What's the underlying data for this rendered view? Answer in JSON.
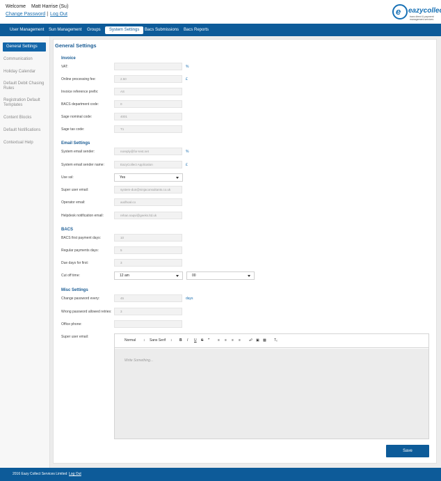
{
  "header": {
    "welcome_label": "Welcome",
    "user_name": "Matt Harrise (Su)",
    "change_password": "Change Password",
    "separator": "|",
    "log_out": "Log Out",
    "logo": {
      "word": "eazycollect",
      "tagline": "bacs direct & payment management services"
    }
  },
  "nav": {
    "items": [
      {
        "label": "User Management"
      },
      {
        "label": "Sun Management"
      },
      {
        "label": "Groups"
      },
      {
        "label": "System Settings"
      },
      {
        "label": "Bacs Submissions"
      },
      {
        "label": "Bacs Reports"
      }
    ],
    "active_item": "System Settings"
  },
  "sidebar": {
    "items": [
      {
        "label": "General Settings"
      },
      {
        "label": "Communication"
      },
      {
        "label": "Holiday Calendar"
      },
      {
        "label": "Default Debit Chasing Rules"
      },
      {
        "label": "Registration Default Templates"
      },
      {
        "label": "Content Blocks"
      },
      {
        "label": "Default Notifications"
      },
      {
        "label": "Contextual Help"
      }
    ],
    "active_item": "General Settings"
  },
  "page": {
    "title": "General Settings",
    "invoice": {
      "heading": "Invoice",
      "vat": {
        "label": "VAT:",
        "value": "",
        "unit": "%"
      },
      "online_fee": {
        "label": "Online processing fee:",
        "value": "2.50",
        "unit": "£"
      },
      "ref_prefix": {
        "label": "Invoice reference prefix:",
        "value": "AS"
      },
      "bacs_dept": {
        "label": "BACS department code:",
        "value": "0"
      },
      "sage_nominal": {
        "label": "Sage nominal code:",
        "value": "4001"
      },
      "sage_tax": {
        "label": "Sage tax code:",
        "value": "T1"
      }
    },
    "email": {
      "heading": "Email Settings",
      "sender": {
        "label": "System email sender:",
        "value": "noreply@for-test.net",
        "unit": "%"
      },
      "sender_name": {
        "label": "System email sender name:",
        "value": "EazyCollect Application",
        "unit": "£"
      },
      "use_ssl": {
        "label": "Use ssl:",
        "value": "Yes"
      },
      "super_user": {
        "label": "Super user email:",
        "value": "system-dun@ninjaconsultants.co.uk"
      },
      "operator": {
        "label": "Operator email:",
        "value": "aodhoal.co"
      },
      "helpdesk": {
        "label": "Helpdesk notification email:",
        "value": "rehan.naqvi@geeks.ltd.uk"
      }
    },
    "bacs": {
      "heading": "BACS",
      "first_payment": {
        "label": "BACS first payment days:",
        "value": "10"
      },
      "regular_payments": {
        "label": "Regular payments days:",
        "value": "5"
      },
      "due_days_first": {
        "label": "Due days for first:",
        "value": "3"
      },
      "cut_off": {
        "label": "Cut off time:",
        "hour": "12 am",
        "minute": "00"
      }
    },
    "misc": {
      "heading": "Misc Settings",
      "change_password": {
        "label": "Change password every:",
        "value": "45",
        "unit": "days"
      },
      "wrong_password": {
        "label": "Wrong password allowed retries:",
        "value": "3"
      },
      "office_phone": {
        "label": "Office phone:",
        "value": ""
      },
      "super_user_email": {
        "label": "Super user email:"
      }
    },
    "editor": {
      "header_format": "Normal",
      "font": "Sans Serif",
      "bold": "B",
      "italic": "I",
      "underline": "U",
      "strike": "S",
      "quote": "”",
      "placeholder": "Write Something..."
    },
    "save_label": "Save"
  },
  "footer": {
    "copyright": "2016 Eazy Collect Services Limited",
    "log_out": "Log Out"
  },
  "colors": {
    "brand": "#0d5b99",
    "link": "#1a6fb0",
    "heading": "#1a5c94"
  }
}
